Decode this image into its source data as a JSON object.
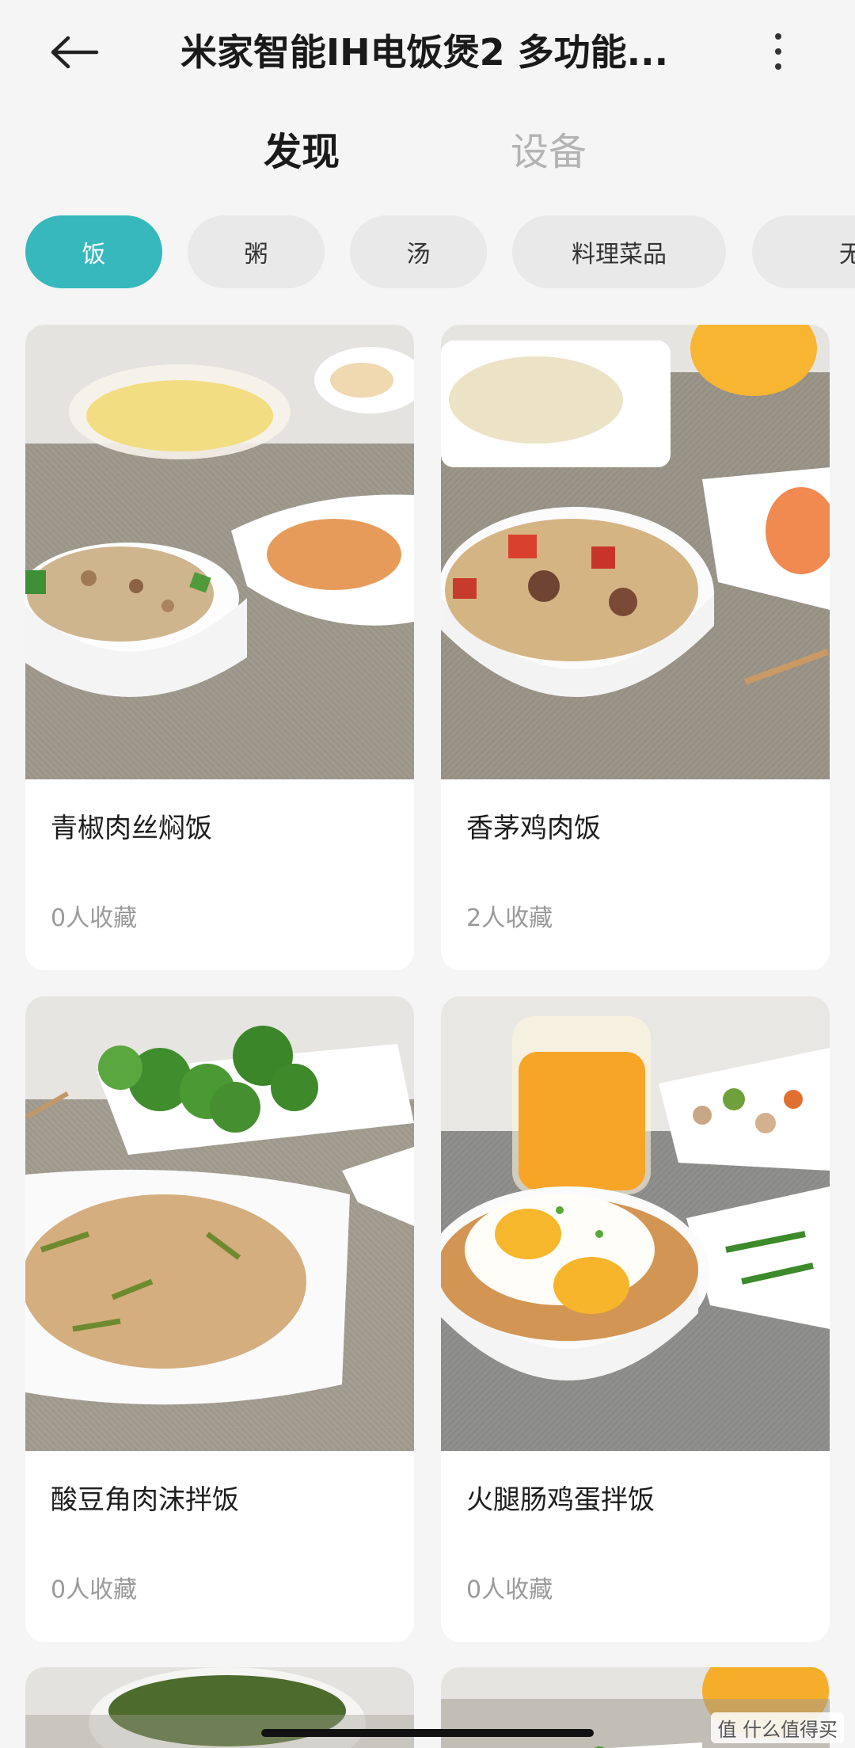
{
  "header": {
    "title": "米家智能IH电饭煲2 多功能...",
    "back_icon": "arrow-left-icon",
    "more_icon": "vertical-ellipsis-icon"
  },
  "tabs": [
    {
      "label": "发现",
      "active": true
    },
    {
      "label": "设备",
      "active": false
    }
  ],
  "categories": [
    {
      "label": "饭",
      "active": true
    },
    {
      "label": "粥",
      "active": false
    },
    {
      "label": "汤",
      "active": false
    },
    {
      "label": "料理菜品",
      "active": false
    },
    {
      "label": "无水",
      "active": false
    }
  ],
  "recipes": [
    {
      "name": "青椒肉丝焖饭",
      "favorites": "0人收藏"
    },
    {
      "name": "香茅鸡肉饭",
      "favorites": "2人收藏"
    },
    {
      "name": "酸豆角肉沫拌饭",
      "favorites": "0人收藏"
    },
    {
      "name": "火腿肠鸡蛋拌饭",
      "favorites": "0人收藏"
    }
  ],
  "watermark": "值 什么值得买",
  "colors": {
    "accent": "#36b8bd",
    "background": "#f5f5f5",
    "muted_text": "#9a9a9a"
  }
}
